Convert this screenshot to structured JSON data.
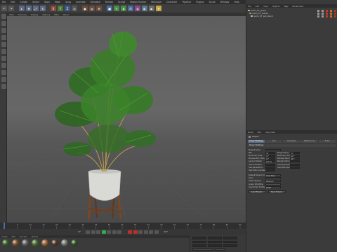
{
  "menubar": {
    "items": [
      "File",
      "Edit",
      "Create",
      "Select",
      "Tools",
      "Mesh",
      "Snap",
      "Animate",
      "Simulate",
      "Render",
      "Sculpt",
      "Motion Tracker",
      "MoGraph",
      "Character",
      "Pipeline",
      "Plugins",
      "Script",
      "Window",
      "Help"
    ]
  },
  "viewport": {
    "menu": [
      "View",
      "Cameras",
      "Display",
      "Options",
      "Filter",
      "Panel"
    ]
  },
  "objects_menu": [
    "File",
    "Edit",
    "View",
    "Objects",
    "Tags",
    "Bookmarks"
  ],
  "objects": [
    {
      "name": "palm_07_group",
      "selected": false,
      "color": "#c9c9c9"
    },
    {
      "name": "palm_07_leaves",
      "selected": false,
      "color": "#7fbf5a"
    },
    {
      "name": "palm_07_pot_stand",
      "selected": false,
      "color": "#c9c9c9"
    }
  ],
  "attributes_menu": [
    "Mode",
    "Edit",
    "User Data"
  ],
  "attributes": {
    "title": "Project",
    "tabs": [
      "Project Settings",
      "Info",
      "Dynamics",
      "Referencing",
      "To Do"
    ],
    "active_tab": "Project Settings",
    "section": "Project Settings",
    "rows": [
      {
        "label": "Project Scale",
        "value": "",
        "label2": "",
        "value2": ""
      },
      {
        "label": "FPS",
        "value": "30",
        "label2": "Project Time",
        "value2": "0 F"
      },
      {
        "label": "Minimum Time",
        "value": "0 F",
        "label2": "Maximum Time",
        "value2": "90 F"
      },
      {
        "label": "Preview Min Time",
        "value": "0 F",
        "label2": "Preview Max Time",
        "value2": "90 F"
      },
      {
        "label": "Level of Detail",
        "value": "100 %",
        "label2": "Render LOD in Editor",
        "value2": ""
      },
      {
        "label": "Use Animation",
        "value": "",
        "label2": "Use Expression",
        "value2": ""
      },
      {
        "label": "Use Generators",
        "value": "",
        "label2": "Use Deformers",
        "value2": ""
      },
      {
        "label": "Use Motion System",
        "value": "",
        "label2": "",
        "value2": ""
      }
    ],
    "rows2": [
      {
        "label": "Default Object Color",
        "value": "Gray Blue"
      },
      {
        "label": "Color",
        "value": ""
      },
      {
        "label": "View Clipping",
        "value": "Medium"
      },
      {
        "label": "Linear Workflow",
        "value": ""
      },
      {
        "label": "Input Color Profile",
        "value": "sRGB"
      }
    ],
    "buttons": [
      "Load Preset...",
      "Save Preset..."
    ]
  },
  "timeline": {
    "ticks": [
      "0",
      "5",
      "10",
      "15",
      "20",
      "25",
      "30",
      "35",
      "40",
      "45",
      "50",
      "55",
      "60",
      "65",
      "70",
      "75",
      "80",
      "85",
      "90"
    ],
    "current_frame": "0 F",
    "end_frame": "90 F"
  },
  "materials_menu": [
    "Create",
    "Edit",
    "Function",
    "Texture"
  ],
  "materials": [
    "#3d6b2a",
    "#8a5a2e",
    "#6b6b6b",
    "#4f7a35",
    "#a66a3a",
    "#5b3c24",
    "#7f7f7f",
    "#2f5a24"
  ],
  "colors": {
    "play": "#3aa84a",
    "record": "#b8312f",
    "selection": "#5a6b84"
  }
}
